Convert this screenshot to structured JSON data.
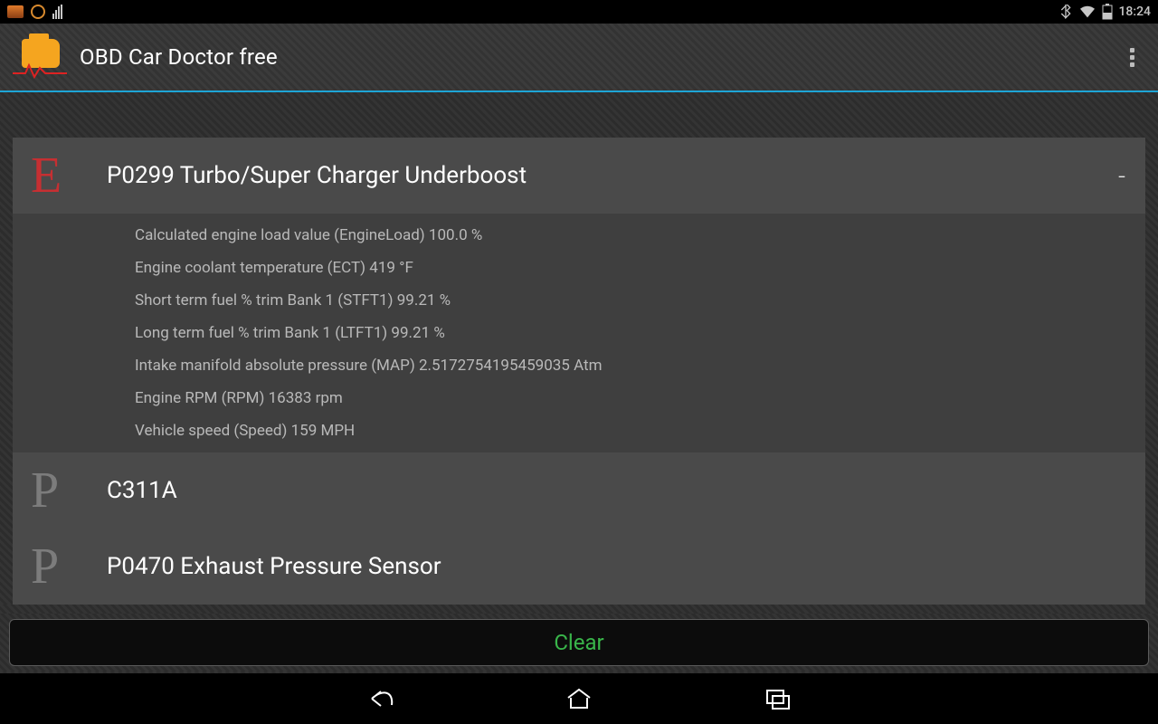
{
  "statusbar": {
    "clock": "18:24"
  },
  "actionbar": {
    "title": "OBD Car Doctor free"
  },
  "codes": [
    {
      "letter": "E",
      "letter_class": "letter-E",
      "title": "P0299 Turbo/Super Charger Underboost",
      "indicator": "-",
      "expanded": true,
      "params": [
        "Calculated engine load value (EngineLoad) 100.0 %",
        "Engine coolant temperature (ECT) 419 °F",
        "Short term fuel % trim Bank 1 (STFT1) 99.21 %",
        "Long term fuel % trim Bank 1 (LTFT1) 99.21 %",
        "Intake manifold absolute pressure (MAP) 2.5172754195459035 Atm",
        "Engine RPM (RPM) 16383 rpm",
        "Vehicle speed (Speed) 159 MPH"
      ]
    },
    {
      "letter": "P",
      "letter_class": "letter-P",
      "title": "C311A",
      "indicator": "",
      "expanded": false,
      "params": []
    },
    {
      "letter": "P",
      "letter_class": "letter-P",
      "title": "P0470 Exhaust Pressure Sensor",
      "indicator": "",
      "expanded": false,
      "params": []
    }
  ],
  "footer": {
    "clear_label": "Clear"
  }
}
